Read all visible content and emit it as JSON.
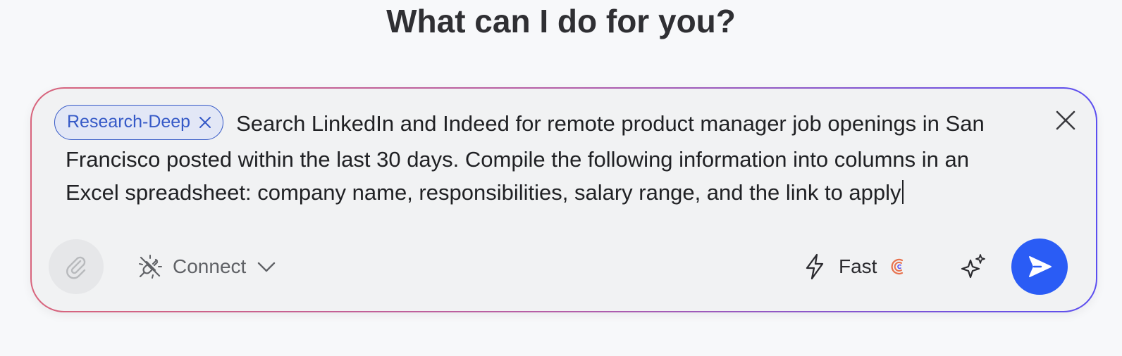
{
  "page": {
    "heading": "What can I do for you?"
  },
  "composer": {
    "chip": {
      "label": "Research-Deep",
      "icon": "close-icon"
    },
    "prompt_text": "Search LinkedIn and Indeed for remote product manager job openings in San Francisco posted within the last 30 days. Compile the following information into columns in an Excel spreadsheet: company name, responsibilities, salary range, and the link to apply",
    "clear_icon": "close-icon",
    "toolbar": {
      "attach_icon": "paperclip-icon",
      "connect_label": "Connect",
      "connect_icon": "plug-icon",
      "connect_chevron": "chevron-down-icon",
      "mode_label": "Fast",
      "mode_icon": "lightning-icon",
      "credit_icon": "credit-icon",
      "magic_icon": "sparkle-icon",
      "send_icon": "send-icon"
    }
  },
  "colors": {
    "accent": "#2a5cf5",
    "chip_border": "#3559c7",
    "chip_bg": "#e2e7f6",
    "gradient_start": "#d8647c",
    "gradient_end": "#5b4ef0"
  }
}
